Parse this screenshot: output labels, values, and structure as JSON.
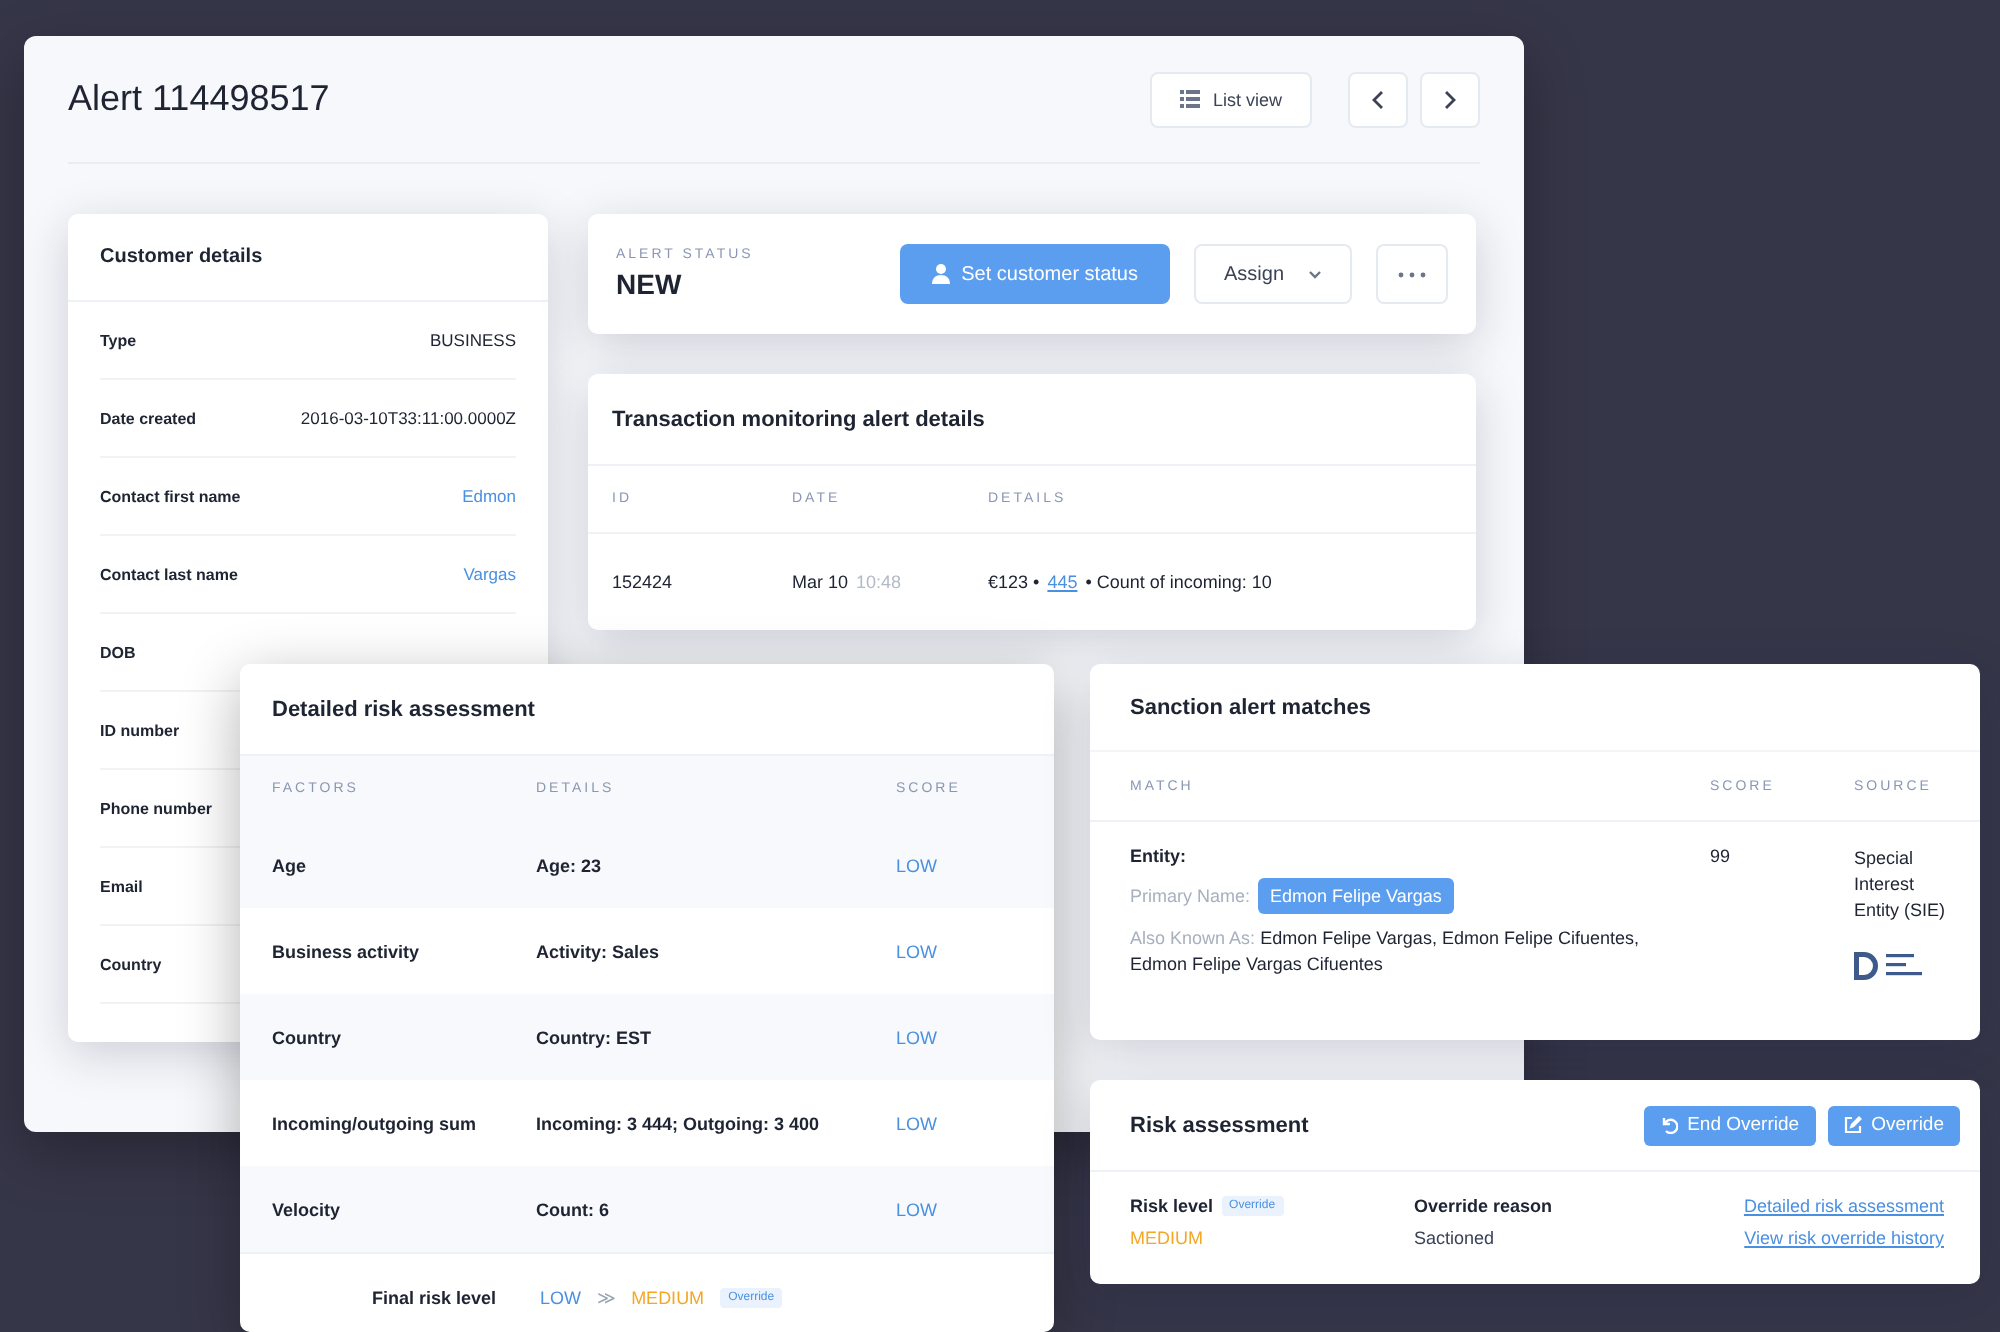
{
  "alert_window": {
    "title": "Alert 114498517",
    "list_view_button": "List view"
  },
  "customer_details": {
    "title": "Customer details",
    "rows": [
      {
        "label": "Type",
        "value": "BUSINESS",
        "kind": "text"
      },
      {
        "label": "Date created",
        "value": "2016-03-10T33:11:00.0000Z",
        "kind": "text"
      },
      {
        "label": "Contact first name",
        "value": "Edmon",
        "kind": "link"
      },
      {
        "label": "Contact last name",
        "value": "Vargas",
        "kind": "link"
      },
      {
        "label": "DOB"
      },
      {
        "label": "ID number"
      },
      {
        "label": "Phone number"
      },
      {
        "label": "Email"
      },
      {
        "label": "Country"
      }
    ]
  },
  "alert_status": {
    "label": "ALERT STATUS",
    "value": "NEW",
    "buttons": [
      {
        "label": "Set customer status",
        "kind": "primary"
      },
      {
        "label": "Assign",
        "kind": "dropdown"
      },
      {
        "kind": "more"
      }
    ]
  },
  "transaction_alert": {
    "title": "Transaction monitoring alert details",
    "columns": [
      "ID",
      "DATE",
      "DETAILS"
    ],
    "rows": [
      {
        "id": "152424",
        "date": "Mar 10",
        "time": "10:48",
        "details": [
          {
            "text": "€123 •",
            "kind": "text"
          },
          {
            "text": "445",
            "kind": "link"
          },
          {
            "text": "• Count of incoming: 10",
            "kind": "text"
          }
        ]
      }
    ]
  },
  "detailed_risk_assessment": {
    "title": "Detailed risk assessment",
    "columns": [
      "FACTORS",
      "DETAILS",
      "SCORE"
    ],
    "rows": [
      {
        "factor": "Age",
        "details": "Age: 23",
        "score": "LOW",
        "color": "#4a90e2"
      },
      {
        "factor": "Business activity",
        "details": "Activity: Sales",
        "score": "LOW",
        "color": "#4a90e2"
      },
      {
        "factor": "Country",
        "details": "Country: EST",
        "score": "LOW",
        "color": "#4a90e2"
      },
      {
        "factor": "Incoming/outgoing sum",
        "details": "Incoming: 3 444; Outgoing: 3 400",
        "score": "LOW",
        "color": "#4a90e2"
      },
      {
        "factor": "Velocity",
        "details": "Count: 6",
        "score": "LOW",
        "color": "#4a90e2"
      }
    ],
    "final": {
      "label": "Final risk level",
      "from": {
        "text": "LOW",
        "kind": "low"
      },
      "separator": "≫",
      "to": {
        "text": "MEDIUM",
        "kind": "medium"
      },
      "badge": "Override"
    }
  },
  "sanction_alert_matches": {
    "title": "Sanction alert matches",
    "columns": [
      "MATCH",
      "SCORE",
      "SOURCE"
    ],
    "rows": [
      {
        "entity_label": "Entity:",
        "primary_name_label": "Primary Name:",
        "primary_name": "Edmon Felipe Vargas",
        "aka_label": "Also Known As:",
        "aka": "Edmon Felipe Vargas, Edmon Felipe Cifuentes, Edmon Felipe Vargas Cifuentes",
        "score": "99",
        "source": "Special Interest Entity (SIE)"
      }
    ]
  },
  "risk_assessment": {
    "title": "Risk assessment",
    "buttons": [
      {
        "label": "End Override",
        "kind": "undo"
      },
      {
        "label": "Override",
        "kind": "edit"
      }
    ],
    "risk_level_label": "Risk level",
    "risk_level_badge": "Override",
    "risk_level": {
      "text": "MEDIUM",
      "kind": "medium"
    },
    "override_reason_label": "Override reason",
    "override_reason": "Sactioned",
    "links": [
      "Detailed risk assessment",
      "View risk override history"
    ]
  }
}
